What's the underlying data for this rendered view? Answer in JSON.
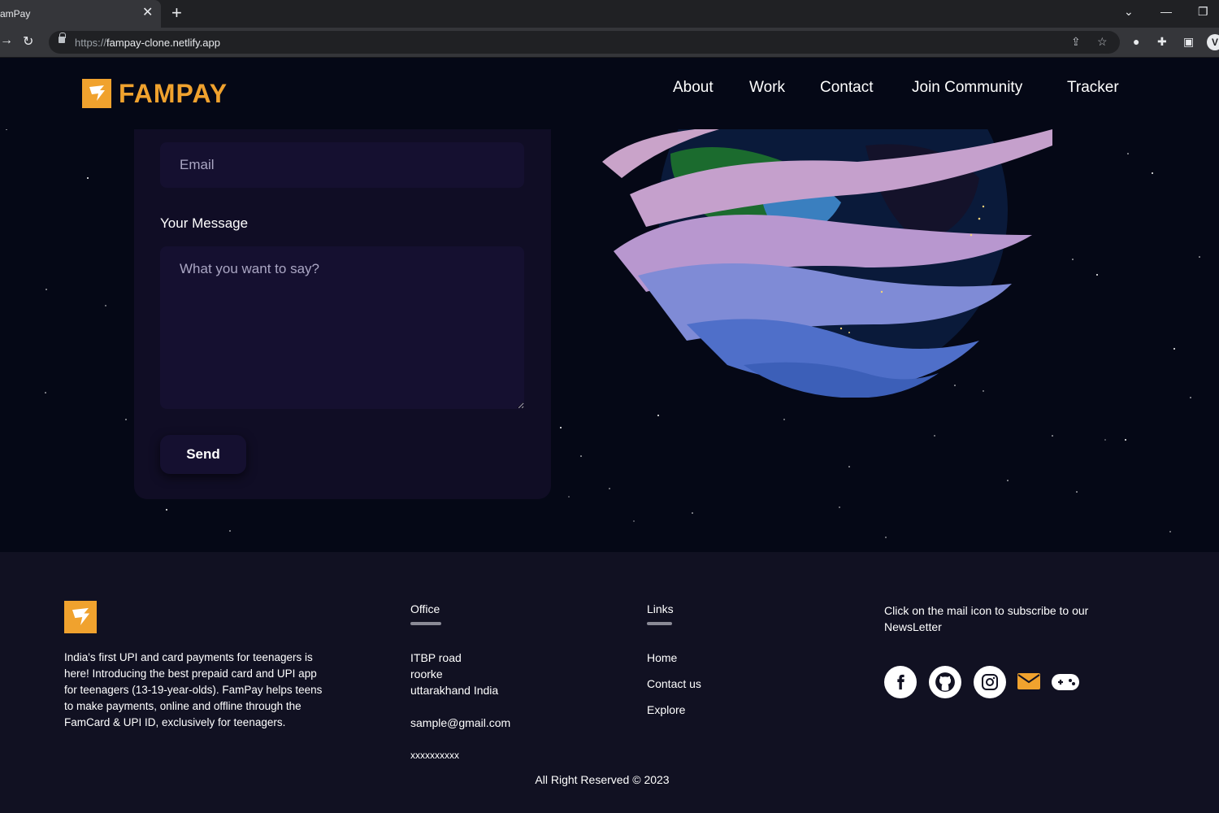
{
  "browser": {
    "tab_title": "amPay",
    "tab_close": "✕",
    "new_tab": "+",
    "url_scheme": "https://",
    "url_host": "fampay-clone.netlify.app",
    "profile_initial": "V"
  },
  "nav": {
    "brand": "FAMPAY",
    "links": [
      "About",
      "Work",
      "Contact",
      "Join Community",
      "Tracker"
    ]
  },
  "contact_form": {
    "email_placeholder": "Email",
    "message_label": "Your Message",
    "message_placeholder": "What you want to say?",
    "send_label": "Send"
  },
  "footer": {
    "description": "India's first UPI and card payments for teenagers is here! Introducing the best prepaid card and UPI app for teenagers (13-19-year-olds). FamPay helps teens to make payments, online and offline through the FamCard & UPI ID, exclusively for teenagers.",
    "office": {
      "heading": "Office",
      "line1": "ITBP road",
      "line2": "roorke",
      "line3": "uttarakhand India",
      "email": "sample@gmail.com",
      "phone": "xxxxxxxxxx"
    },
    "links": {
      "heading": "Links",
      "items": [
        "Home",
        "Contact us",
        "Explore"
      ]
    },
    "newsletter_text": "Click on the mail icon to subscribe to our NewsLetter",
    "social_icons": [
      "facebook-icon",
      "github-icon",
      "instagram-icon",
      "mail-icon",
      "gamepad-icon"
    ],
    "copyright": "All Right Reserved © 2023"
  },
  "colors": {
    "accent": "#f0a22e",
    "background": "#050816",
    "card": "#100d25",
    "input": "#151030",
    "footer": "#111122"
  }
}
